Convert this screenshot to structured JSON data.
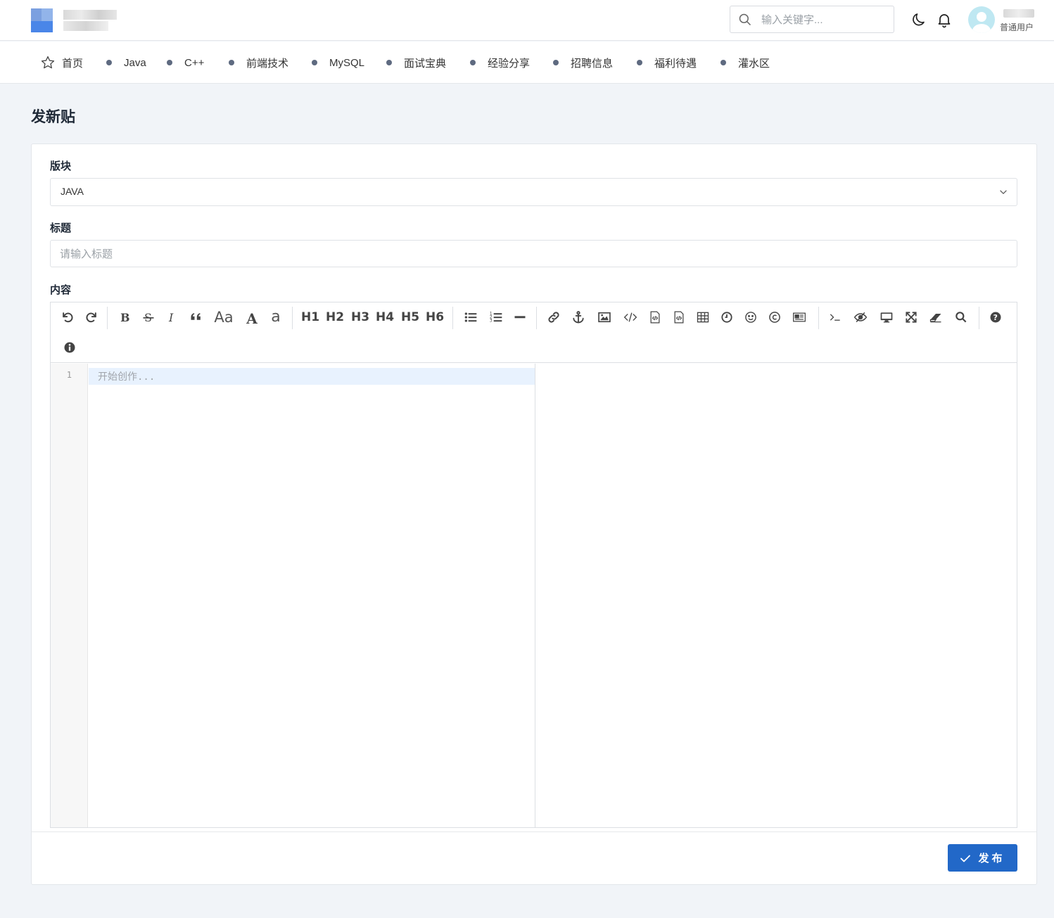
{
  "header": {
    "search_placeholder": "输入关键字...",
    "user_role": "普通用户"
  },
  "nav": {
    "items": [
      {
        "label": "首页",
        "icon": "star-icon"
      },
      {
        "label": "Java"
      },
      {
        "label": "C++"
      },
      {
        "label": "前端技术"
      },
      {
        "label": "MySQL"
      },
      {
        "label": "面试宝典"
      },
      {
        "label": "经验分享"
      },
      {
        "label": "招聘信息"
      },
      {
        "label": "福利待遇"
      },
      {
        "label": "灌水区"
      }
    ]
  },
  "page": {
    "title": "发新贴"
  },
  "form": {
    "section_label": "版块",
    "section_value": "JAVA",
    "title_label": "标题",
    "title_placeholder": "请输入标题",
    "content_label": "内容"
  },
  "editor": {
    "line_number": "1",
    "placeholder": "开始创作...",
    "heading_buttons": [
      "H1",
      "H2",
      "H3",
      "H4",
      "H5",
      "H6"
    ],
    "case_buttons": [
      "Aa",
      "A",
      "a"
    ]
  },
  "actions": {
    "publish_label": "发布"
  },
  "colors": {
    "primary": "#2268c8",
    "background": "#f1f4f8",
    "active_line": "#e8f2fe"
  }
}
